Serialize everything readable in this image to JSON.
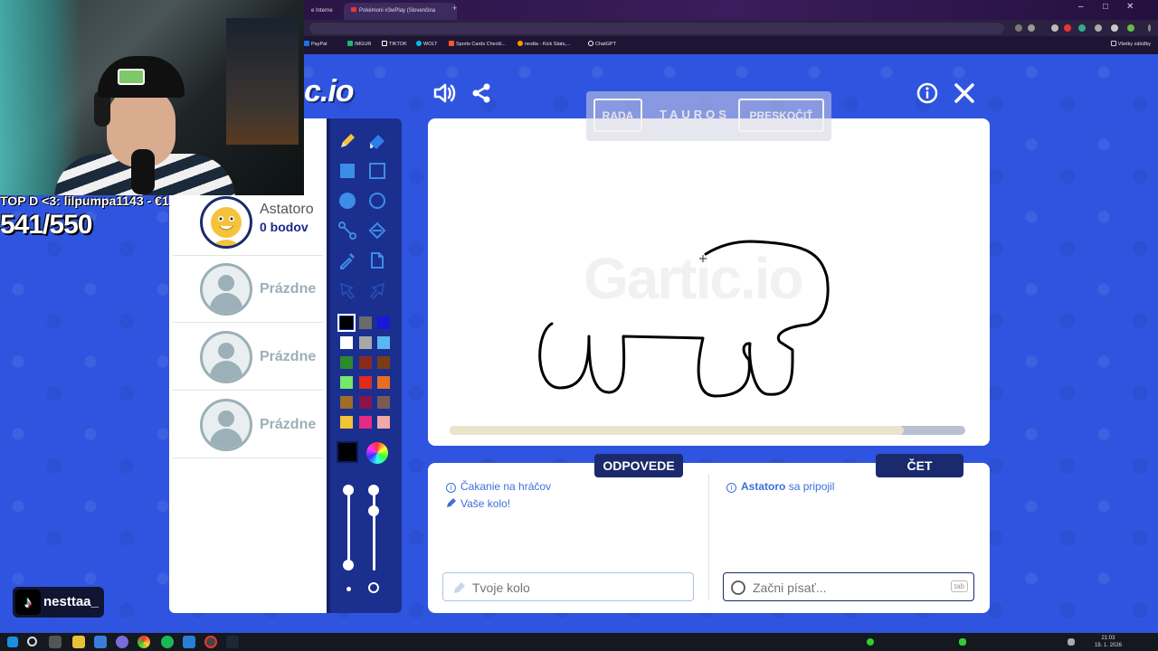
{
  "browser": {
    "tabs": [
      {
        "label": "e Interne"
      },
      {
        "label": "Pokémoni #3wPlay (Slovenčina"
      }
    ],
    "bookmarks": [
      {
        "label": "PayPal",
        "color": "#1a73e8"
      },
      {
        "label": "IMGUR",
        "color": "#1bb76e"
      },
      {
        "label": "TIKTOK",
        "color": "#222222"
      },
      {
        "label": "WOLT",
        "color": "#00c2e8"
      },
      {
        "label": "Sports Cards Checkl...",
        "color": "#ff5722"
      },
      {
        "label": "nestta - Kick Stats,...",
        "color": "#ff9800"
      },
      {
        "label": "ChatGPT",
        "color": "#ffffff"
      }
    ],
    "all_bookmarks_label": "Všetky záložky"
  },
  "game": {
    "logo_text": "c.io",
    "hint_button": "RADA",
    "word": "TAUROS",
    "skip_button": "PRESKOČIŤ",
    "watermark": "Gartic.io",
    "round_progress": 0.88,
    "players": [
      {
        "name": "Astatoro",
        "score": "0 bodov",
        "empty": false
      },
      {
        "name": "Prázdne",
        "empty": true
      },
      {
        "name": "Prázdne",
        "empty": true
      },
      {
        "name": "Prázdne",
        "empty": true
      }
    ],
    "palette": [
      "#000000",
      "#6b6b6b",
      "#1a17d9",
      "#ffffff",
      "#a8a8a8",
      "#5ab8ef",
      "#2d8a2c",
      "#8b2a1a",
      "#7a3e14",
      "#74e86a",
      "#e02a1c",
      "#e86d25",
      "#a06b2b",
      "#8a1449",
      "#7a5a57",
      "#f0c338",
      "#e22c86",
      "#f0a8a8"
    ],
    "answers_tab": "ODPOVEDE",
    "chat_tab": "ČET",
    "answers": [
      {
        "text": "Čakanie na hráčov",
        "icon": "info-icon"
      },
      {
        "text": "Vaše kolo!",
        "icon": "pencil-icon"
      }
    ],
    "chat": [
      {
        "player": "Astatoro",
        "text": "sa pripojil",
        "icon": "info-icon"
      }
    ],
    "answer_placeholder": "Tvoje kolo",
    "chat_placeholder": "Začni písať...",
    "tab_key": "tab"
  },
  "stream": {
    "top_donator": "TOP D <3: lilpumpa1143 - €1",
    "counter": "541/550",
    "tiktok_handle": "nesttaa_"
  },
  "taskbar": {
    "time": "21:03",
    "date": "19. 1. 2026"
  },
  "colors": {
    "game_bg": "#2f55e0",
    "dark_blue": "#1a2a6c",
    "accent_text": "#3e6fd8",
    "empty_slot": "#9bb0b7"
  }
}
